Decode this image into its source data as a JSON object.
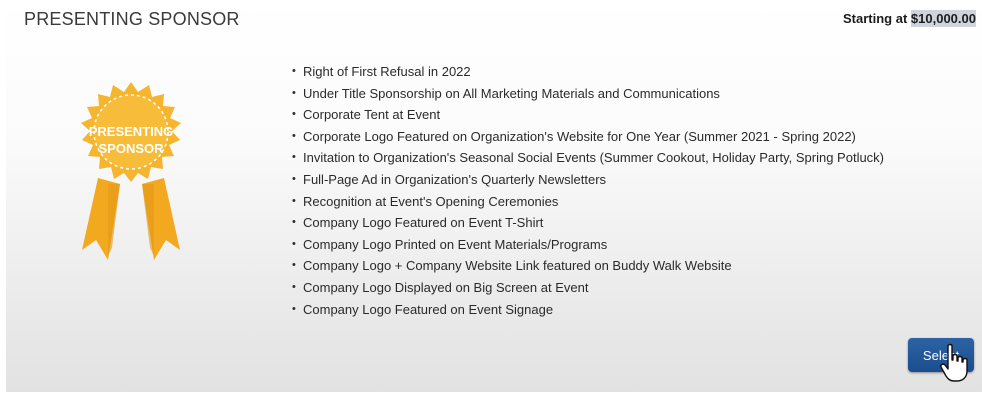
{
  "sponsor": {
    "title": "PRESENTING SPONSOR",
    "price_prefix": "Starting at ",
    "price_amount": "$10,000.00"
  },
  "badge": {
    "line1": "PRESENTING",
    "line2": "SPONSOR",
    "icon": "award-ribbon-icon",
    "colors": {
      "gold": "#f5b52e",
      "gold_dark": "#e39a16",
      "ribbon": "#f2a91f"
    }
  },
  "benefits": [
    "Right of First Refusal in 2022",
    "Under Title Sponsorship on All Marketing Materials and Communications",
    "Corporate Tent at Event",
    "Corporate Logo Featured on Organization's Website for One Year (Summer 2021 - Spring 2022)",
    "Invitation to Organization's Seasonal Social Events (Summer Cookout, Holiday Party, Spring Potluck)",
    "Full-Page Ad in Organization's Quarterly Newsletters",
    "Recognition at Event's Opening Ceremonies",
    "Company Logo Featured on Event T-Shirt",
    "Company Logo Printed on Event Materials/Programs",
    "Company Logo + Company Website Link featured on Buddy Walk Website",
    "Company Logo Displayed on Big Screen at Event",
    "Company Logo Featured on Event Signage"
  ],
  "actions": {
    "select_label": "Select"
  },
  "theme": {
    "button_color": "#1f5296",
    "text_color": "#2a2a2a"
  }
}
